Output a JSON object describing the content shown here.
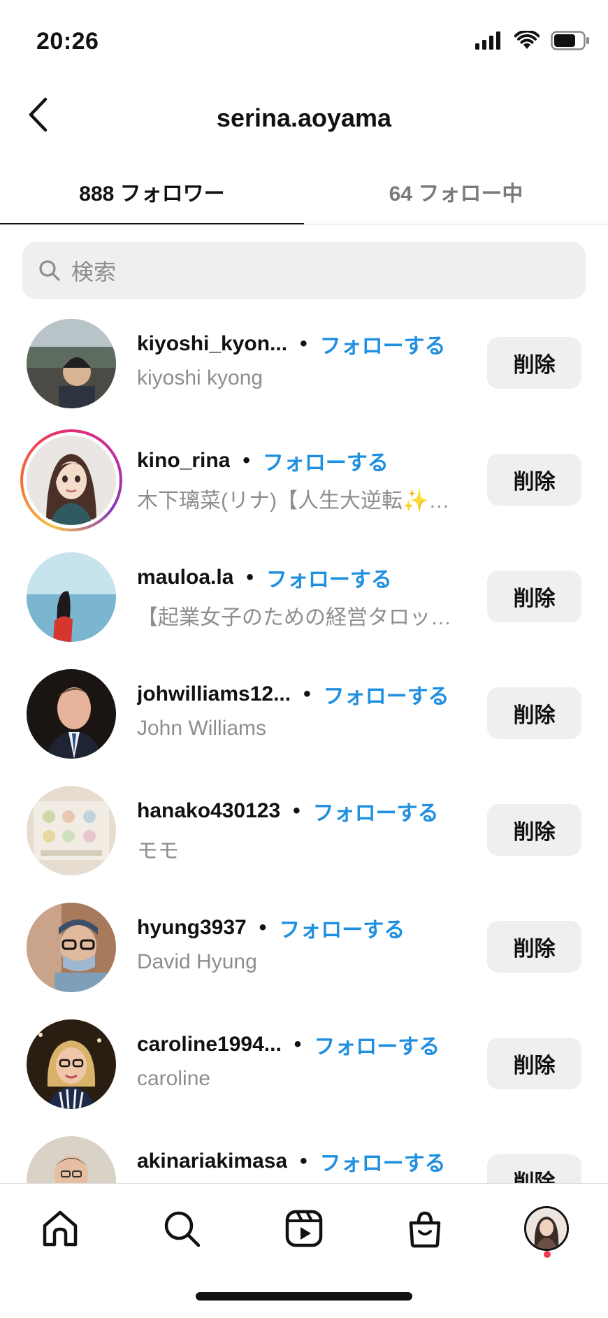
{
  "status_bar": {
    "time": "20:26"
  },
  "header": {
    "title": "serina.aoyama"
  },
  "tabs": [
    {
      "label": "888 フォロワー",
      "active": true
    },
    {
      "label": "64 フォロー中",
      "active": false
    }
  ],
  "search": {
    "placeholder": "検索"
  },
  "followers": [
    {
      "username": "kiyoshi_kyon...",
      "name": "kiyoshi kyong",
      "follow_label": "フォローする",
      "remove_label": "削除",
      "has_story": false
    },
    {
      "username": "kino_rina",
      "name": "木下璃菜(リナ)【人生大逆転✨…",
      "follow_label": "フォローする",
      "remove_label": "削除",
      "has_story": true
    },
    {
      "username": "mauloa.la",
      "name": "【起業女子のための経営タロッ…",
      "follow_label": "フォローする",
      "remove_label": "削除",
      "has_story": false
    },
    {
      "username": "johwilliams12...",
      "name": "John Williams",
      "follow_label": "フォローする",
      "remove_label": "削除",
      "has_story": false
    },
    {
      "username": "hanako430123",
      "name": "モモ",
      "follow_label": "フォローする",
      "remove_label": "削除",
      "has_story": false
    },
    {
      "username": "hyung3937",
      "name": "David Hyung",
      "follow_label": "フォローする",
      "remove_label": "削除",
      "has_story": false
    },
    {
      "username": "caroline1994...",
      "name": "caroline",
      "follow_label": "フォローする",
      "remove_label": "削除",
      "has_story": false
    },
    {
      "username": "akinariakimasa",
      "name": "",
      "follow_label": "フォローする",
      "remove_label": "削除",
      "has_story": false
    }
  ],
  "separator": "•",
  "bottom_nav": [
    {
      "icon": "home-icon"
    },
    {
      "icon": "search-icon"
    },
    {
      "icon": "reels-icon"
    },
    {
      "icon": "shop-icon"
    },
    {
      "icon": "profile-avatar",
      "notification": true
    }
  ],
  "colors": {
    "link": "#1f8fe0",
    "muted": "#8e8e8e",
    "button_bg": "#efefef",
    "notification": "#ef3b4a"
  }
}
